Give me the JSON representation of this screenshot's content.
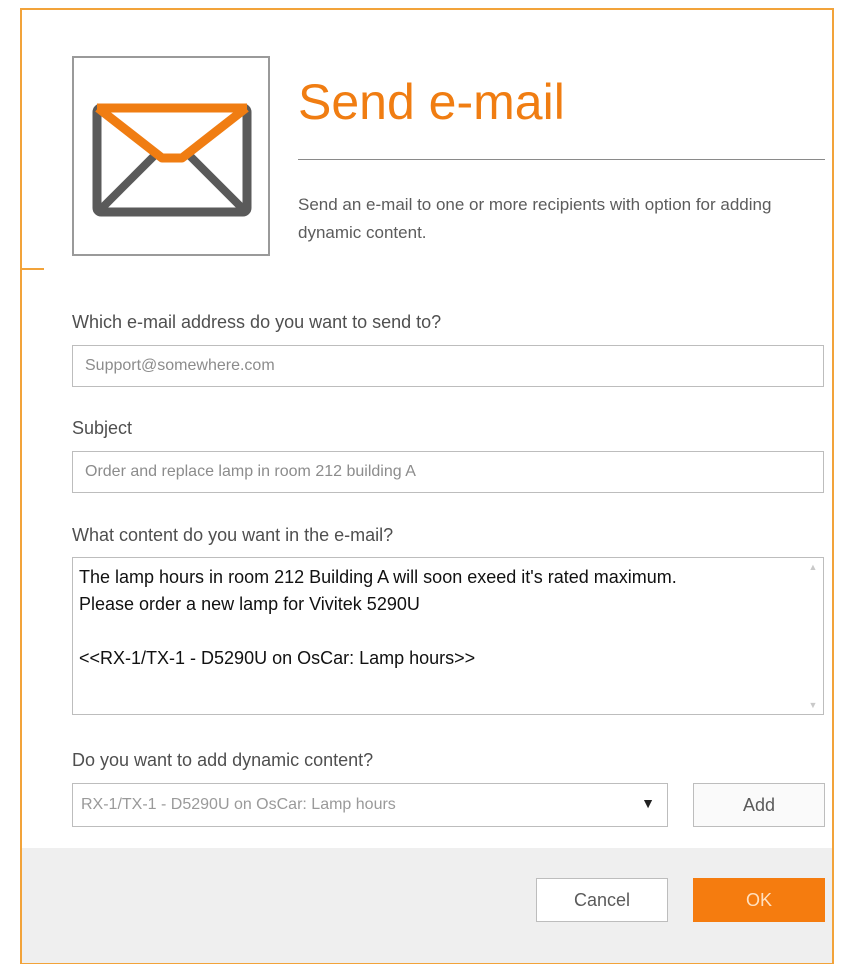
{
  "dialog": {
    "title": "Send e-mail",
    "description": "Send an e-mail to one or more recipients with option for adding dynamic content.",
    "icon": "envelope-icon",
    "accent_color": "#f07d12"
  },
  "form": {
    "email_label": "Which e-mail address do you want to send to?",
    "email_value": "Support@somewhere.com",
    "subject_label": "Subject",
    "subject_value": "Order and replace lamp in room 212 building A",
    "content_label": "What content do you want in the e-mail?",
    "content_value": "The lamp hours in room 212 Building A will soon exeed it's rated maximum.\nPlease order a new lamp for Vivitek 5290U\n\n<<RX-1/TX-1 - D5290U on OsCar: Lamp hours>>",
    "dynamic_label": "Do you want to add dynamic content?",
    "dynamic_selected": "RX-1/TX-1 - D5290U on OsCar: Lamp hours",
    "add_label": "Add"
  },
  "footer": {
    "cancel_label": "Cancel",
    "ok_label": "OK",
    "ok_color": "#f57c0f"
  }
}
